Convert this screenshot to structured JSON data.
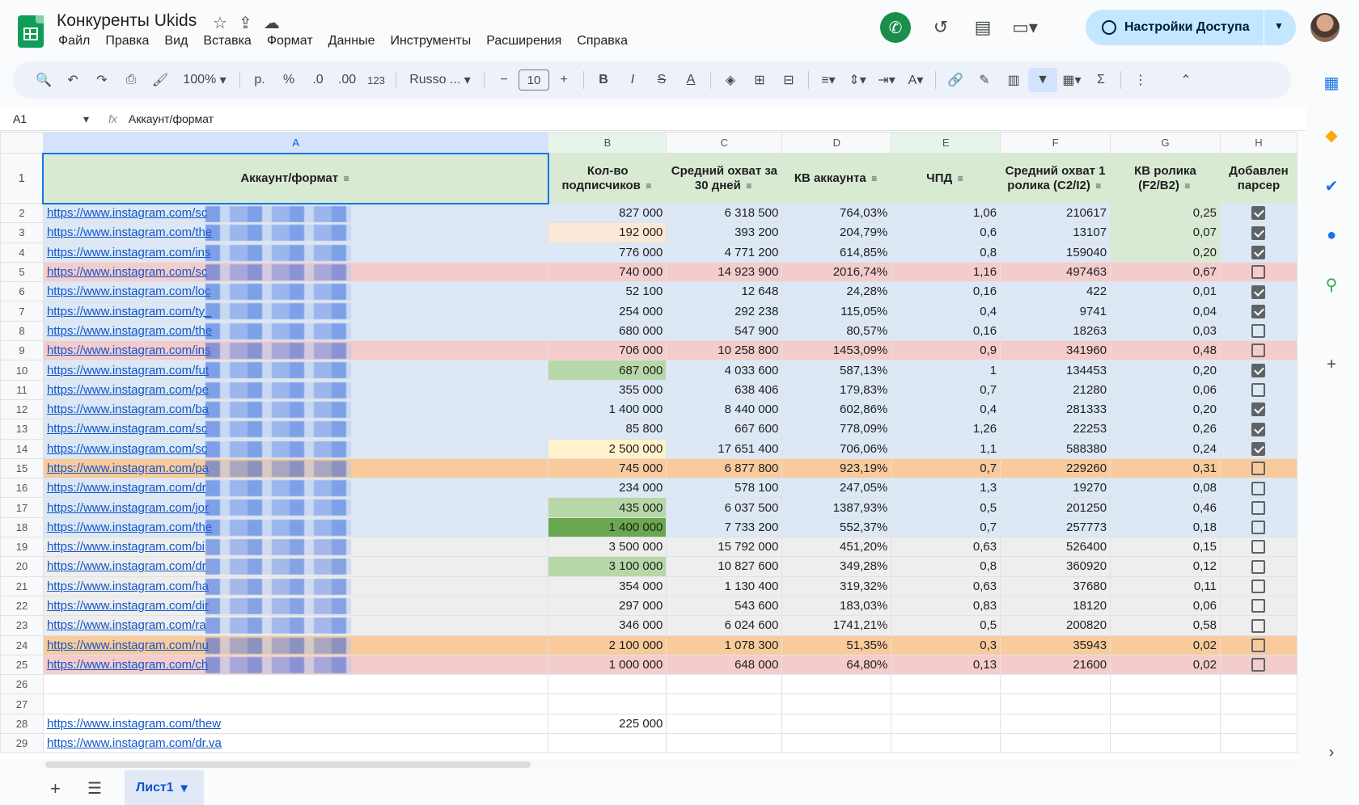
{
  "doc": {
    "title": "Конкуренты Ukids"
  },
  "menu": [
    "Файл",
    "Правка",
    "Вид",
    "Вставка",
    "Формат",
    "Данные",
    "Инструменты",
    "Расширения",
    "Справка"
  ],
  "share": {
    "label": "Настройки Доступа"
  },
  "toolbar": {
    "zoom": "100%",
    "currency": "р.",
    "percent": "%",
    "dec_less": ".0",
    "dec_more": ".00",
    "format": "123",
    "font": "Russo ...",
    "font_size": "10"
  },
  "formula": {
    "cell": "A1",
    "fx": "fx",
    "value": "Аккаунт/формат"
  },
  "columns": [
    "A",
    "B",
    "C",
    "D",
    "E",
    "F",
    "G",
    "H"
  ],
  "headers": [
    "Аккаунт/формат",
    "Кол-во подписчиков",
    "Средний охват за 30 дней",
    "КВ аккаунта",
    "ЧПД",
    "Средний охват 1 ролика (C2/I2)",
    "КВ ролика (F2/B2)",
    "Добавлен парсер"
  ],
  "rows": [
    {
      "n": "2",
      "url": "https://www.instagram.com/sc",
      "b": "827 000",
      "c": "6 318 500",
      "d": "764,03%",
      "e": "1,06",
      "f": "210617",
      "g": "0,25",
      "h": true,
      "row_bg": "#dce8f5",
      "b_bg": "",
      "g_bg": "#d9ead3"
    },
    {
      "n": "3",
      "url": "https://www.instagram.com/the",
      "b": "192 000",
      "c": "393 200",
      "d": "204,79%",
      "e": "0,6",
      "f": "13107",
      "g": "0,07",
      "h": true,
      "row_bg": "#dce8f5",
      "b_bg": "#fce8d6",
      "g_bg": "#d9ead3"
    },
    {
      "n": "4",
      "url": "https://www.instagram.com/ins",
      "b": "776 000",
      "c": "4 771 200",
      "d": "614,85%",
      "e": "0,8",
      "f": "159040",
      "g": "0,20",
      "h": true,
      "row_bg": "#dce8f5",
      "b_bg": "",
      "g_bg": "#d9ead3"
    },
    {
      "n": "5",
      "url": "https://www.instagram.com/sc",
      "b": "740 000",
      "c": "14 923 900",
      "d": "2016,74%",
      "e": "1,16",
      "f": "497463",
      "g": "0,67",
      "h": false,
      "row_bg": "#f4cccc",
      "b_bg": "",
      "g_bg": ""
    },
    {
      "n": "6",
      "url": "https://www.instagram.com/loc",
      "b": "52 100",
      "c": "12 648",
      "d": "24,28%",
      "e": "0,16",
      "f": "422",
      "g": "0,01",
      "h": true,
      "row_bg": "#dce8f5",
      "b_bg": "",
      "g_bg": ""
    },
    {
      "n": "7",
      "url": "https://www.instagram.com/ty_",
      "b": "254 000",
      "c": "292 238",
      "d": "115,05%",
      "e": "0,4",
      "f": "9741",
      "g": "0,04",
      "h": true,
      "row_bg": "#dce8f5",
      "b_bg": "",
      "g_bg": ""
    },
    {
      "n": "8",
      "url": "https://www.instagram.com/the",
      "b": "680 000",
      "c": "547 900",
      "d": "80,57%",
      "e": "0,16",
      "f": "18263",
      "g": "0,03",
      "h": false,
      "row_bg": "#dce8f5",
      "b_bg": "",
      "g_bg": ""
    },
    {
      "n": "9",
      "url": "https://www.instagram.com/ins",
      "b": "706 000",
      "c": "10 258 800",
      "d": "1453,09%",
      "e": "0,9",
      "f": "341960",
      "g": "0,48",
      "h": false,
      "row_bg": "#f4cccc",
      "b_bg": "",
      "g_bg": ""
    },
    {
      "n": "10",
      "url": "https://www.instagram.com/fut",
      "b": "687 000",
      "c": "4 033 600",
      "d": "587,13%",
      "e": "1",
      "f": "134453",
      "g": "0,20",
      "h": true,
      "row_bg": "#dce8f5",
      "b_bg": "#b6d7a8",
      "g_bg": ""
    },
    {
      "n": "11",
      "url": "https://www.instagram.com/pe",
      "b": "355 000",
      "c": "638 406",
      "d": "179,83%",
      "e": "0,7",
      "f": "21280",
      "g": "0,06",
      "h": false,
      "row_bg": "#dce8f5",
      "b_bg": "",
      "g_bg": ""
    },
    {
      "n": "12",
      "url": "https://www.instagram.com/ba",
      "b": "1 400 000",
      "c": "8 440 000",
      "d": "602,86%",
      "e": "0,4",
      "f": "281333",
      "g": "0,20",
      "h": true,
      "row_bg": "#dce8f5",
      "b_bg": "",
      "g_bg": ""
    },
    {
      "n": "13",
      "url": "https://www.instagram.com/sc",
      "b": "85 800",
      "c": "667 600",
      "d": "778,09%",
      "e": "1,26",
      "f": "22253",
      "g": "0,26",
      "h": true,
      "row_bg": "#dce8f5",
      "b_bg": "",
      "g_bg": ""
    },
    {
      "n": "14",
      "url": "https://www.instagram.com/sc",
      "b": "2 500 000",
      "c": "17 651 400",
      "d": "706,06%",
      "e": "1,1",
      "f": "588380",
      "g": "0,24",
      "h": true,
      "row_bg": "#dce8f5",
      "b_bg": "#fff2cc",
      "g_bg": ""
    },
    {
      "n": "15",
      "url": "https://www.instagram.com/pa",
      "b": "745 000",
      "c": "6 877 800",
      "d": "923,19%",
      "e": "0,7",
      "f": "229260",
      "g": "0,31",
      "h": false,
      "row_bg": "#f9cb9c",
      "b_bg": "",
      "g_bg": ""
    },
    {
      "n": "16",
      "url": "https://www.instagram.com/dr",
      "b": "234 000",
      "c": "578 100",
      "d": "247,05%",
      "e": "1,3",
      "f": "19270",
      "g": "0,08",
      "h": false,
      "row_bg": "#dce8f5",
      "b_bg": "",
      "g_bg": ""
    },
    {
      "n": "17",
      "url": "https://www.instagram.com/jor",
      "b": "435 000",
      "c": "6 037 500",
      "d": "1387,93%",
      "e": "0,5",
      "f": "201250",
      "g": "0,46",
      "h": false,
      "row_bg": "#dce8f5",
      "b_bg": "#b6d7a8",
      "g_bg": ""
    },
    {
      "n": "18",
      "url": "https://www.instagram.com/the",
      "b": "1 400 000",
      "c": "7 733 200",
      "d": "552,37%",
      "e": "0,7",
      "f": "257773",
      "g": "0,18",
      "h": false,
      "row_bg": "#dce8f5",
      "b_bg": "#6aa84f",
      "g_bg": ""
    },
    {
      "n": "19",
      "url": "https://www.instagram.com/bi",
      "b": "3 500 000",
      "c": "15 792 000",
      "d": "451,20%",
      "e": "0,63",
      "f": "526400",
      "g": "0,15",
      "h": false,
      "row_bg": "#eeeeee",
      "b_bg": "",
      "g_bg": ""
    },
    {
      "n": "20",
      "url": "https://www.instagram.com/dr",
      "b": "3 100 000",
      "c": "10 827 600",
      "d": "349,28%",
      "e": "0,8",
      "f": "360920",
      "g": "0,12",
      "h": false,
      "row_bg": "#eeeeee",
      "b_bg": "#b6d7a8",
      "g_bg": ""
    },
    {
      "n": "21",
      "url": "https://www.instagram.com/ha",
      "b": "354 000",
      "c": "1 130 400",
      "d": "319,32%",
      "e": "0,63",
      "f": "37680",
      "g": "0,11",
      "h": false,
      "row_bg": "#eeeeee",
      "b_bg": "",
      "g_bg": ""
    },
    {
      "n": "22",
      "url": "https://www.instagram.com/dir",
      "b": "297 000",
      "c": "543 600",
      "d": "183,03%",
      "e": "0,83",
      "f": "18120",
      "g": "0,06",
      "h": false,
      "row_bg": "#eeeeee",
      "b_bg": "",
      "g_bg": ""
    },
    {
      "n": "23",
      "url": "https://www.instagram.com/ra",
      "b": "346 000",
      "c": "6 024 600",
      "d": "1741,21%",
      "e": "0,5",
      "f": "200820",
      "g": "0,58",
      "h": false,
      "row_bg": "#eeeeee",
      "b_bg": "",
      "g_bg": ""
    },
    {
      "n": "24",
      "url": "https://www.instagram.com/nu",
      "b": "2 100 000",
      "c": "1 078 300",
      "d": "51,35%",
      "e": "0,3",
      "f": "35943",
      "g": "0,02",
      "h": false,
      "row_bg": "#f9cb9c",
      "b_bg": "",
      "g_bg": ""
    },
    {
      "n": "25",
      "url": "https://www.instagram.com/ch",
      "b": "1 000 000",
      "c": "648 000",
      "d": "64,80%",
      "e": "0,13",
      "f": "21600",
      "g": "0,02",
      "h": false,
      "row_bg": "#f4cccc",
      "b_bg": "",
      "g_bg": ""
    }
  ],
  "extra_rows": [
    {
      "n": "26",
      "url": "",
      "b": ""
    },
    {
      "n": "27",
      "url": "",
      "b": ""
    },
    {
      "n": "28",
      "url": "https://www.instagram.com/thew",
      "b": "225 000"
    },
    {
      "n": "29",
      "url": "https://www.instagram.com/dr.va",
      "b": ""
    }
  ],
  "sheet_tab": {
    "label": "Лист1"
  }
}
